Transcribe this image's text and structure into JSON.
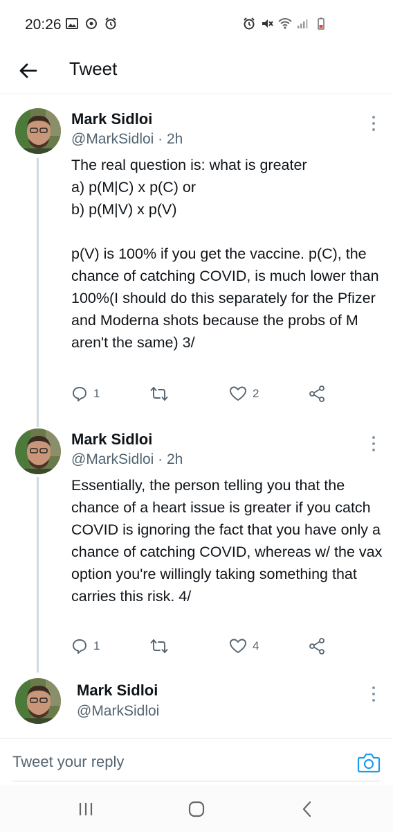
{
  "status_bar": {
    "time": "20:26"
  },
  "header": {
    "title": "Tweet"
  },
  "tweets": [
    {
      "name": "Mark Sidloi",
      "handle": "@MarkSidloi · 2h",
      "text": "The real question is: what is greater\na) p(M|C) x p(C) or\nb) p(M|V) x p(V)\n\np(V) is 100% if you get the vaccine. p(C), the chance of catching COVID, is much lower than 100%(I should do this separately for the Pfizer and Moderna shots because the probs of M aren't the same) 3/",
      "replies": "1",
      "likes": "2"
    },
    {
      "name": "Mark Sidloi",
      "handle": "@MarkSidloi · 2h",
      "text": "Essentially, the person telling you that the chance of a heart issue is greater if you catch COVID is ignoring the fact that you have only a chance of catching COVID, whereas w/ the vax option you're willingly taking something that carries this risk. 4/",
      "replies": "1",
      "likes": "4"
    },
    {
      "name": "Mark Sidloi",
      "handle": "@MarkSidloi"
    }
  ],
  "reply": {
    "placeholder": "Tweet your reply"
  },
  "icons": {
    "back": "arrow-left-icon",
    "reply": "speech-bubble-icon",
    "retweet": "retweet-icon",
    "like": "heart-icon",
    "share": "share-icon",
    "camera": "camera-icon"
  },
  "colors": {
    "accent": "#1d9bf0",
    "secondary_text": "#536471",
    "thread_line": "#cfd9de"
  }
}
